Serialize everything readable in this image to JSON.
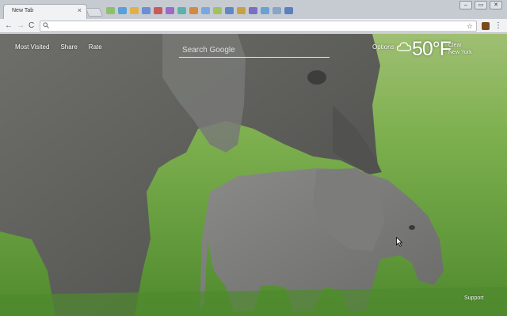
{
  "browser": {
    "tab_title": "New Tab",
    "tab_close": "×",
    "win_minimize": "–",
    "win_restore": "▭",
    "win_close": "✕",
    "back": "←",
    "forward": "→",
    "reload": "C",
    "omnibox_icon": "search-icon",
    "omnibox_value": "",
    "star": "☆",
    "menu": "⋮",
    "extension_colors": [
      "#8fbf6a",
      "#5aa0d8",
      "#e2b04a",
      "#6b8fd2",
      "#c85a5a",
      "#9a6bc8",
      "#59b3a8",
      "#d28a3c",
      "#7aa7e0",
      "#a1c35a",
      "#5f87c4",
      "#c9a03e",
      "#7c6ec0",
      "#6aa1d1",
      "#8aa4c8",
      "#5b7fbf"
    ]
  },
  "page": {
    "nav": [
      "Most Visited",
      "Share",
      "Rate"
    ],
    "search_placeholder": "Search Google",
    "options": "Options",
    "weather": {
      "icon": "cloud-icon",
      "temp": "50°F",
      "condition": "Clear",
      "location": "New York"
    },
    "support": "Support",
    "background": "elephant-mother-and-calf-photo"
  }
}
